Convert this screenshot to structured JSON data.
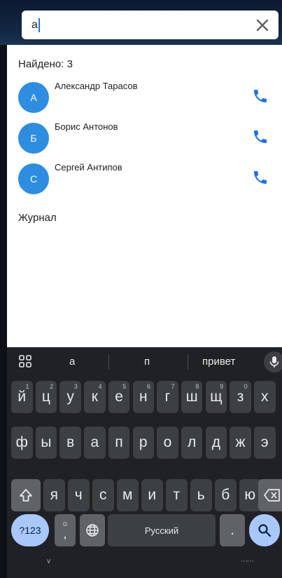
{
  "search": {
    "query": "а"
  },
  "results": {
    "found_label": "Найдено: 3",
    "contacts": [
      {
        "initial": "А",
        "name": "Александр Тарасов"
      },
      {
        "initial": "Б",
        "name": "Борис Антонов"
      },
      {
        "initial": "С",
        "name": "Сергей Антипов"
      }
    ],
    "journal_label": "Журнал"
  },
  "keyboard": {
    "suggestions": [
      "а",
      "п",
      "привет"
    ],
    "row1": [
      {
        "k": "й",
        "h": "1"
      },
      {
        "k": "ц",
        "h": "2"
      },
      {
        "k": "у",
        "h": "3"
      },
      {
        "k": "к",
        "h": "4"
      },
      {
        "k": "е",
        "h": "5"
      },
      {
        "k": "н",
        "h": "6"
      },
      {
        "k": "г",
        "h": "7"
      },
      {
        "k": "ш",
        "h": "8"
      },
      {
        "k": "щ",
        "h": "9"
      },
      {
        "k": "з",
        "h": "0"
      },
      {
        "k": "х",
        "h": ""
      }
    ],
    "row2": [
      "ф",
      "ы",
      "в",
      "а",
      "п",
      "р",
      "о",
      "л",
      "д",
      "ж",
      "э"
    ],
    "row3": [
      "я",
      "ч",
      "с",
      "м",
      "и",
      "т",
      "ь",
      "б",
      "ю"
    ],
    "symbols_label": "?123",
    "comma_label": ",",
    "emoji_glyph": "☺",
    "space_label": "Русский",
    "period_label": ".",
    "icons": {
      "clear": "close-icon",
      "call": "phone-icon",
      "grid": "apps-grid-icon",
      "mic": "microphone-icon",
      "shift": "shift-icon",
      "backspace": "backspace-icon",
      "globe": "globe-icon",
      "search": "search-icon"
    }
  },
  "colors": {
    "accent": "#2d8de0",
    "call": "#1a73e8",
    "keyboard_bg": "#202124",
    "key": "#3c4043"
  }
}
